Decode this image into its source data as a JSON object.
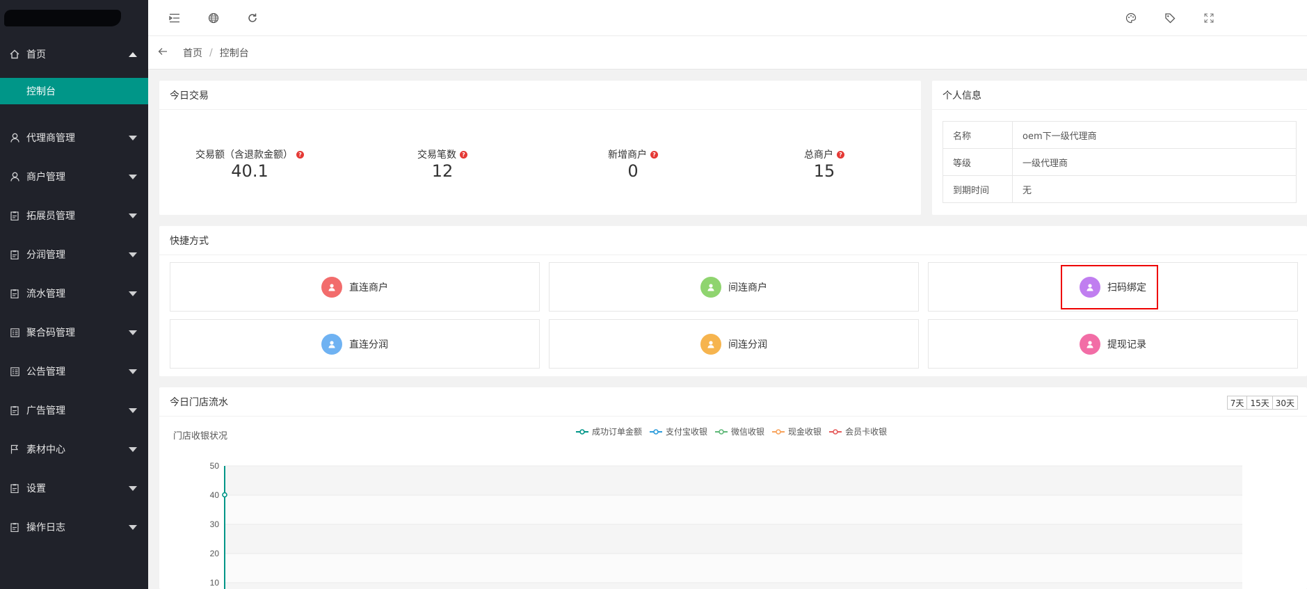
{
  "sidebar": {
    "home": {
      "label": "首页",
      "icon": "home-icon"
    },
    "home_sub": "控制台",
    "items": [
      {
        "label": "代理商管理",
        "icon": "user-icon"
      },
      {
        "label": "商户管理",
        "icon": "user-icon"
      },
      {
        "label": "拓展员管理",
        "icon": "clipboard-icon"
      },
      {
        "label": "分润管理",
        "icon": "clipboard-icon"
      },
      {
        "label": "流水管理",
        "icon": "clipboard-icon"
      },
      {
        "label": "聚合码管理",
        "icon": "list-icon"
      },
      {
        "label": "公告管理",
        "icon": "list-icon"
      },
      {
        "label": "广告管理",
        "icon": "clipboard-icon"
      },
      {
        "label": "素材中心",
        "icon": "flag-icon"
      },
      {
        "label": "设置",
        "icon": "clipboard-icon"
      },
      {
        "label": "操作日志",
        "icon": "clipboard-icon"
      }
    ]
  },
  "breadcrumb": {
    "home": "首页",
    "sep": "/",
    "current": "控制台"
  },
  "trade": {
    "title": "今日交易",
    "stats": [
      {
        "label": "交易额（含退款金额）",
        "value": "40.1"
      },
      {
        "label": "交易笔数",
        "value": "12"
      },
      {
        "label": "新增商户",
        "value": "0"
      },
      {
        "label": "总商户",
        "value": "15"
      }
    ]
  },
  "info": {
    "title": "个人信息",
    "rows": [
      {
        "key": "名称",
        "value": "oem下一级代理商"
      },
      {
        "key": "等级",
        "value": "一级代理商"
      },
      {
        "key": "到期时间",
        "value": "无"
      }
    ]
  },
  "quick": {
    "title": "快捷方式",
    "buttons": [
      {
        "label": "直连商户",
        "color": "#f26c6c"
      },
      {
        "label": "间连商户",
        "color": "#8fd46f"
      },
      {
        "label": "扫码绑定",
        "color": "#c07ef0"
      },
      {
        "label": "直连分润",
        "color": "#6fb2f2"
      },
      {
        "label": "间连分润",
        "color": "#f6b44e"
      },
      {
        "label": "提现记录",
        "color": "#f26da6"
      }
    ]
  },
  "flow": {
    "title": "今日门店流水",
    "ranges": [
      "7天",
      "15天",
      "30天"
    ],
    "chart_title": "门店收银状况"
  },
  "chart_data": {
    "type": "line",
    "title": "门店收银状况",
    "ylim": [
      0,
      50
    ],
    "yticks": [
      10,
      20,
      30,
      40,
      50
    ],
    "legend_position": "top",
    "grid": true,
    "series": [
      {
        "name": "成功订单金额",
        "color": "#009688",
        "values": [
          40.1
        ]
      },
      {
        "name": "支付宝收银",
        "color": "#2d9cdb",
        "values": []
      },
      {
        "name": "微信收银",
        "color": "#5fb878",
        "values": []
      },
      {
        "name": "现金收银",
        "color": "#f7a35c",
        "values": []
      },
      {
        "name": "会员卡收银",
        "color": "#e55b5b",
        "values": []
      }
    ]
  }
}
